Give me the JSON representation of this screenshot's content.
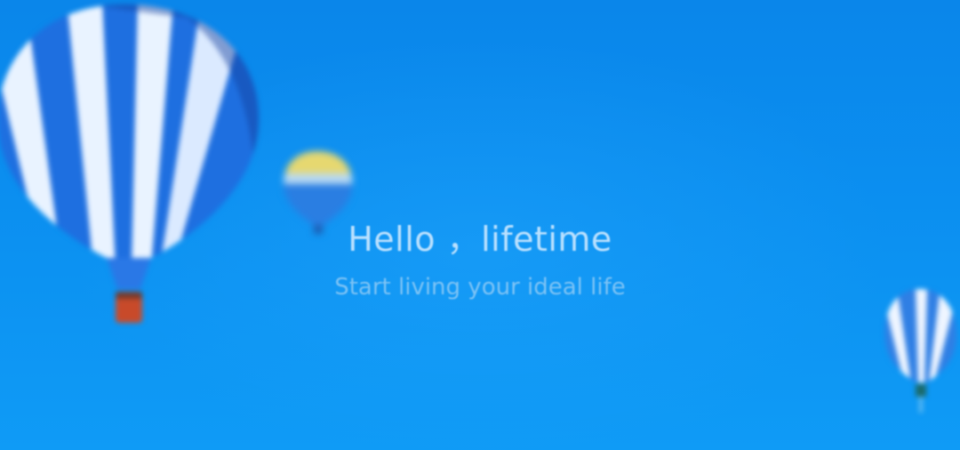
{
  "hero": {
    "headline": "Hello ，lifetime",
    "subline": "Start living your ideal life"
  },
  "colors": {
    "sky": "#0b8ff0",
    "balloon_blue": "#1e6fe0",
    "balloon_white": "#e9f3ff",
    "basket": "#c84a2a"
  },
  "images": {
    "balloons": [
      "large-blue-white-balloon",
      "small-yellow-blue-balloon",
      "small-white-blue-balloon"
    ]
  }
}
